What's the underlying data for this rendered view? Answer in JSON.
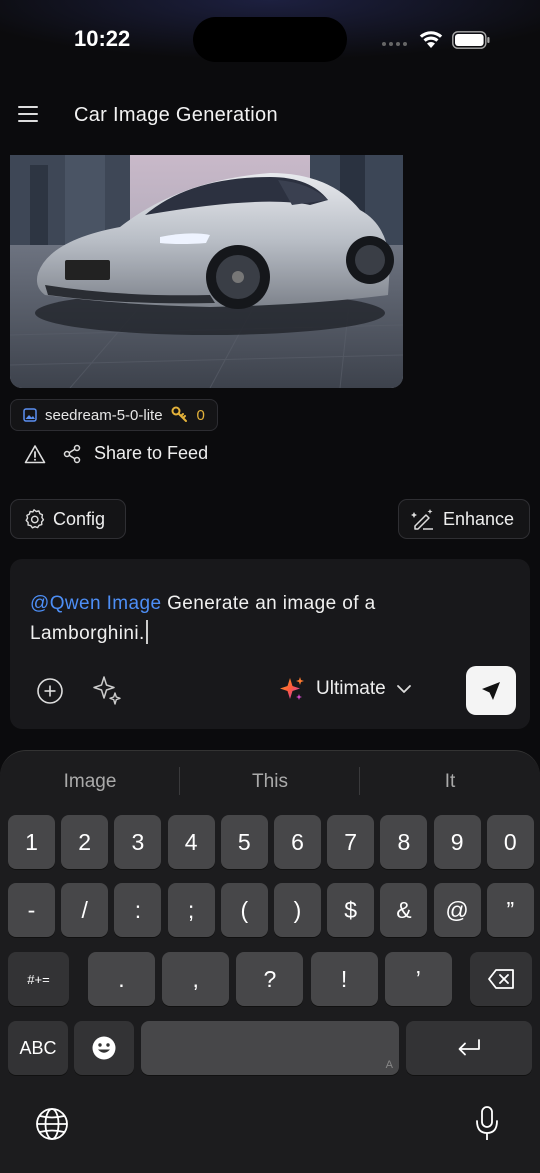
{
  "status": {
    "time": "10:22"
  },
  "header": {
    "title": "Car Image Generation"
  },
  "result": {
    "model": "seedream-5-0-lite",
    "cost": "0",
    "share_label": "Share to Feed"
  },
  "actions": {
    "config_label": "Config",
    "enhance_label": "Enhance"
  },
  "composer": {
    "mention": "@Qwen Image",
    "prompt_line1": " Generate an image of a",
    "prompt_line2": "Lamborghini.",
    "quality_label": "Ultimate"
  },
  "keyboard": {
    "suggestions": [
      "Image",
      "This",
      "It"
    ],
    "row1": [
      "1",
      "2",
      "3",
      "4",
      "5",
      "6",
      "7",
      "8",
      "9",
      "0"
    ],
    "row2": [
      "-",
      "/",
      ":",
      ";",
      "(",
      ")",
      "$",
      "&",
      "@",
      "”"
    ],
    "row3_mode": "#+=",
    "row3": [
      ".",
      ",",
      "?",
      "!",
      "’"
    ],
    "abc_label": "ABC",
    "space_hint": "A"
  }
}
